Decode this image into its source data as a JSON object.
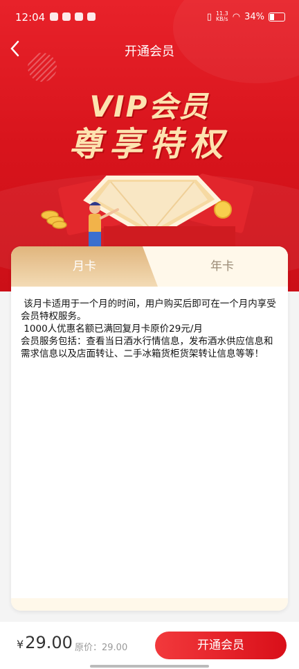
{
  "status_bar": {
    "time": "12:04",
    "net_speed": "11.3\nKB/s",
    "battery": "34%"
  },
  "nav": {
    "back_icon": "chevron-left-icon",
    "title": "开通会员"
  },
  "hero": {
    "headline": "VIP会员",
    "subheadline": "尊享特权"
  },
  "tabs": [
    {
      "label": "月卡",
      "active": true
    },
    {
      "label": "年卡",
      "active": false
    }
  ],
  "description": " 该月卡适用于一个月的时间，用户购买后即可在一个月内享受会员特权服务。\n 1000人优惠名额已满回复月卡原价29元/月\n会员服务包括：查看当日酒水行情信息，发布酒水供应信息和需求信息以及店面转让、二手冰箱货柜货架转让信息等等！",
  "bottom": {
    "currency": "¥",
    "price": "29.00",
    "original_label": "原价：29.00",
    "buy_button": "开通会员"
  },
  "colors": {
    "primary_red": "#e8222a",
    "gold": "#e0b57d",
    "button_red": "#d90f19"
  }
}
